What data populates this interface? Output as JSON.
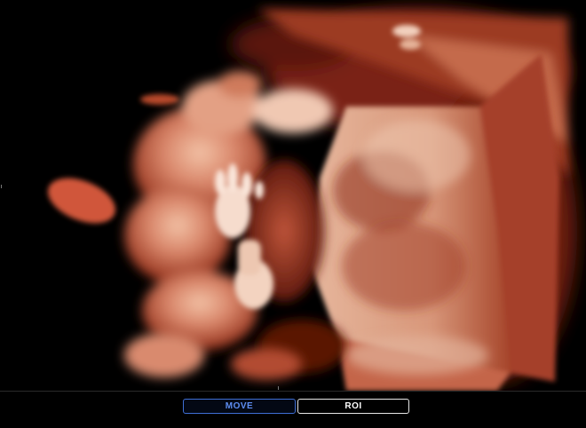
{
  "viewport": {
    "description_icon": "ultrasound-3d-render"
  },
  "toolbar": {
    "move_label": "MOVE",
    "roi_label": "ROI"
  },
  "colors": {
    "active_button": "#5e8ef2",
    "inactive_button": "#ffffff",
    "render_base": "#b0442a"
  }
}
